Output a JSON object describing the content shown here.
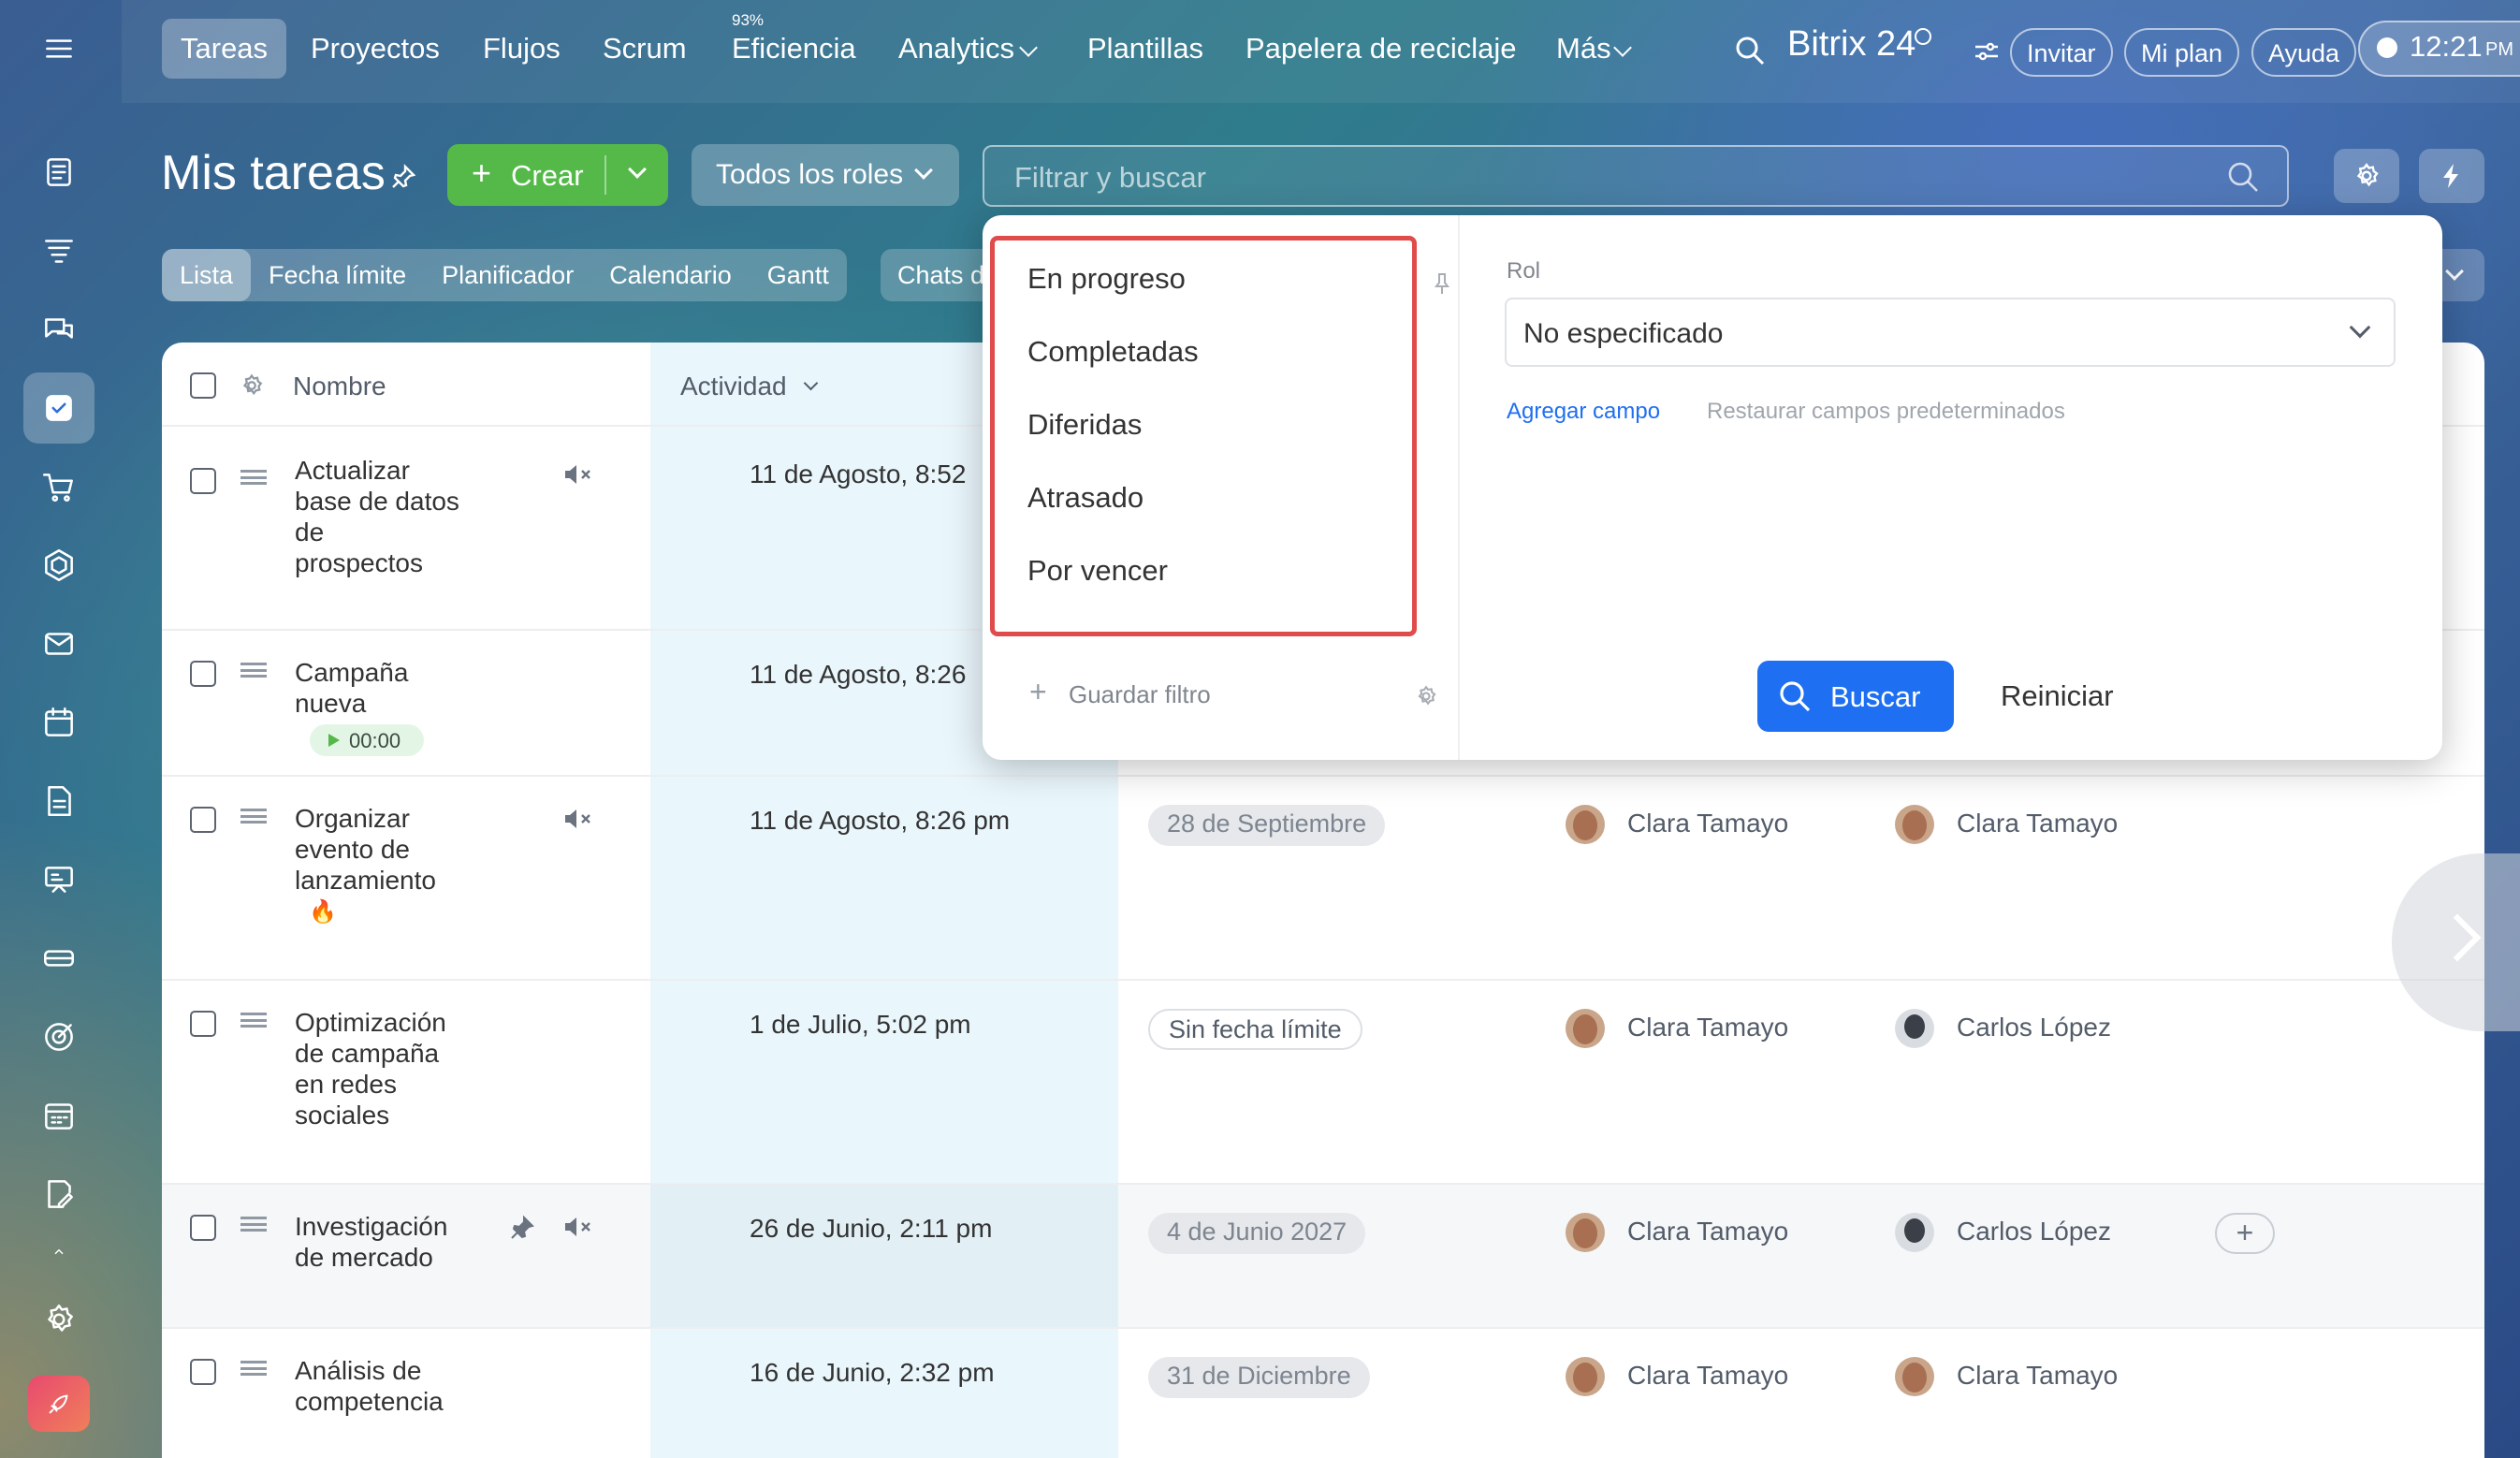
{
  "nav": {
    "items": [
      "Tareas",
      "Proyectos",
      "Flujos",
      "Scrum",
      "Eficiencia",
      "Analytics",
      "Plantillas",
      "Papelera de reciclaje",
      "Más"
    ],
    "efficiency_badge": "93%",
    "brand": "Bitrix 24",
    "invite": "Invitar",
    "plan": "Mi plan",
    "help": "Ayuda",
    "time": "12:21",
    "time_suffix": "PM"
  },
  "header": {
    "title": "Mis tareas",
    "create_label": "Crear",
    "roles_label": "Todos los roles",
    "search_placeholder": "Filtrar y buscar"
  },
  "view_tabs": [
    "Lista",
    "Fecha límite",
    "Planificador",
    "Calendario",
    "Gantt",
    "Chats d"
  ],
  "table": {
    "col_name": "Nombre",
    "col_activity": "Actividad",
    "rows": [
      {
        "name": [
          "Actualizar",
          "base de datos",
          "de",
          "prospectos"
        ],
        "activity": "11 de Agosto, 8:52",
        "muted": true
      },
      {
        "name": [
          "Campaña",
          "nueva"
        ],
        "activity": "11 de Agosto, 8:26",
        "timer": "00:00"
      },
      {
        "name": [
          "Organizar",
          "evento de",
          "lanzamiento"
        ],
        "activity": "11 de Agosto, 8:26 pm",
        "deadline": "28 de Septiembre",
        "created_by": "Clara Tamayo",
        "responsible": "Clara Tamayo",
        "muted": true,
        "hot": true
      },
      {
        "name": [
          "Optimización",
          "de campaña",
          "en redes",
          "sociales"
        ],
        "activity": "1 de Julio, 5:02 pm",
        "deadline": "Sin fecha límite",
        "created_by": "Clara Tamayo",
        "responsible": "Carlos López"
      },
      {
        "name": [
          "Investigación",
          "de mercado"
        ],
        "activity": "26 de Junio, 2:11 pm",
        "deadline": "4 de Junio 2027",
        "created_by": "Clara Tamayo",
        "responsible": "Carlos López",
        "muted": true,
        "pinned": true
      },
      {
        "name": [
          "Análisis de",
          "competencia"
        ],
        "activity": "16 de Junio, 2:32 pm",
        "deadline": "31 de Diciembre",
        "created_by": "Clara Tamayo",
        "responsible": "Clara Tamayo"
      }
    ]
  },
  "filter_popup": {
    "presets": [
      "En progreso",
      "Completadas",
      "Diferidas",
      "Atrasado",
      "Por vencer"
    ],
    "save_filter": "Guardar filtro",
    "role_label": "Rol",
    "role_value": "No especificado",
    "add_field": "Agregar campo",
    "restore_fields": "Restaurar campos predeterminados",
    "search_button": "Buscar",
    "reset_button": "Reiniciar"
  },
  "colors": {
    "accent_green": "#54b948",
    "accent_blue": "#1e6ff1",
    "highlight_red": "#e04b4b"
  }
}
